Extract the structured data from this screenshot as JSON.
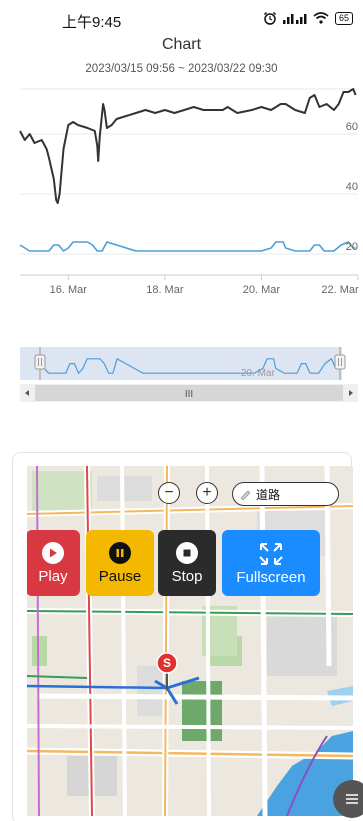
{
  "status_bar": {
    "time": "上午9:45",
    "signal_1": "HD",
    "signal_2": "HD",
    "battery": "65"
  },
  "chart": {
    "title": "Chart",
    "range": "2023/03/15 09:56 ~ 2023/03/22 09:30"
  },
  "chart_data": {
    "type": "line",
    "x_range": [
      "2023-03-15",
      "2023-03-22"
    ],
    "x_tick_labels": [
      "16. Mar",
      "18. Mar",
      "20. Mar",
      "22. Mar"
    ],
    "x_tick_days": [
      1,
      3,
      5,
      7
    ],
    "y_tick_labels": [
      "20",
      "40",
      "60"
    ],
    "ylim": [
      17,
      75
    ],
    "grid": true,
    "series": [
      {
        "color": "#333333",
        "points": [
          [
            0.0,
            61
          ],
          [
            0.1,
            58
          ],
          [
            0.2,
            60
          ],
          [
            0.3,
            57
          ],
          [
            0.45,
            58
          ],
          [
            0.55,
            55
          ],
          [
            0.6,
            52
          ],
          [
            0.7,
            45
          ],
          [
            0.75,
            38
          ],
          [
            0.78,
            37
          ],
          [
            0.82,
            40
          ],
          [
            0.9,
            55
          ],
          [
            1.0,
            63
          ],
          [
            1.1,
            64
          ],
          [
            1.2,
            63
          ],
          [
            1.4,
            62
          ],
          [
            1.55,
            61
          ],
          [
            1.6,
            56
          ],
          [
            1.62,
            51
          ],
          [
            1.65,
            59
          ],
          [
            1.72,
            70
          ],
          [
            1.75,
            68
          ],
          [
            1.8,
            62
          ],
          [
            1.9,
            63
          ],
          [
            2.0,
            65
          ],
          [
            2.2,
            66
          ],
          [
            2.4,
            67
          ],
          [
            2.6,
            68
          ],
          [
            2.8,
            67
          ],
          [
            3.0,
            68
          ],
          [
            3.2,
            67
          ],
          [
            3.4,
            68
          ],
          [
            3.6,
            69
          ],
          [
            3.8,
            68
          ],
          [
            4.0,
            68
          ],
          [
            4.2,
            68
          ],
          [
            4.3,
            69
          ],
          [
            4.5,
            67
          ],
          [
            4.8,
            68
          ],
          [
            5.0,
            69
          ],
          [
            5.2,
            68
          ],
          [
            5.4,
            70
          ],
          [
            5.5,
            70
          ],
          [
            5.7,
            68
          ],
          [
            5.9,
            67
          ],
          [
            6.0,
            72
          ],
          [
            6.1,
            73
          ],
          [
            6.2,
            69
          ],
          [
            6.35,
            70
          ],
          [
            6.5,
            68
          ],
          [
            6.6,
            70
          ],
          [
            6.7,
            74
          ],
          [
            6.8,
            74
          ],
          [
            6.9,
            75
          ],
          [
            6.95,
            73
          ]
        ]
      },
      {
        "color": "#4a9fd8",
        "points": [
          [
            0.0,
            23
          ],
          [
            0.2,
            21
          ],
          [
            0.4,
            21
          ],
          [
            0.6,
            21
          ],
          [
            0.7,
            23
          ],
          [
            0.8,
            23
          ],
          [
            0.9,
            21
          ],
          [
            1.0,
            22
          ],
          [
            1.1,
            24
          ],
          [
            1.2,
            24
          ],
          [
            1.4,
            24
          ],
          [
            1.5,
            23
          ],
          [
            1.6,
            21
          ],
          [
            1.7,
            21
          ],
          [
            1.8,
            24
          ],
          [
            2.0,
            23
          ],
          [
            2.2,
            22
          ],
          [
            2.4,
            21
          ],
          [
            2.6,
            21
          ],
          [
            2.8,
            21
          ],
          [
            3.0,
            21
          ],
          [
            3.2,
            21
          ],
          [
            3.4,
            21
          ],
          [
            3.6,
            21
          ],
          [
            3.8,
            21
          ],
          [
            4.0,
            21
          ],
          [
            4.2,
            21
          ],
          [
            4.4,
            21
          ],
          [
            4.6,
            21
          ],
          [
            4.8,
            21
          ],
          [
            5.0,
            21
          ],
          [
            5.2,
            22
          ],
          [
            5.3,
            24
          ],
          [
            5.45,
            24
          ],
          [
            5.5,
            22
          ],
          [
            5.7,
            21
          ],
          [
            5.9,
            21
          ],
          [
            6.0,
            21
          ],
          [
            6.1,
            23
          ],
          [
            6.2,
            23
          ],
          [
            6.3,
            21
          ],
          [
            6.5,
            21
          ],
          [
            6.65,
            23
          ],
          [
            6.8,
            24
          ],
          [
            6.9,
            22
          ],
          [
            6.95,
            22
          ]
        ]
      }
    ]
  },
  "navigator": {
    "tick_label": "20. Mar",
    "scrollbar_grip": "III"
  },
  "map": {
    "zoom_out": "−",
    "zoom_in": "+",
    "layer": "道路",
    "buttons": {
      "play": "Play",
      "pause": "Pause",
      "stop": "Stop",
      "fullscreen": "Fullscreen"
    },
    "marker": "S",
    "colors": {
      "play": "#d73842",
      "pause": "#f5b800",
      "stop": "#2b2b2b",
      "fullscreen": "#1a8cff"
    }
  }
}
